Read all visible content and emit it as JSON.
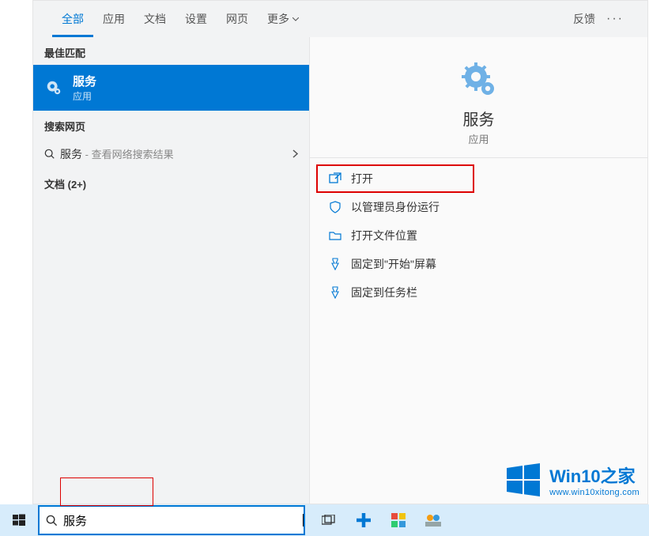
{
  "tabs": {
    "all": "全部",
    "apps": "应用",
    "docs": "文档",
    "settings": "设置",
    "web": "网页",
    "more": "更多",
    "feedback": "反馈",
    "ellipsis": "···"
  },
  "left": {
    "best_label": "最佳匹配",
    "best_title": "服务",
    "best_sub": "应用",
    "web_label": "搜索网页",
    "web_term": "服务",
    "web_dash": " - ",
    "web_sub": "查看网络搜索结果",
    "docs_label": "文档 (2+)"
  },
  "detail": {
    "title": "服务",
    "sub": "应用",
    "actions": {
      "open": "打开",
      "run_admin": "以管理员身份运行",
      "open_location": "打开文件位置",
      "pin_start": "固定到\"开始\"屏幕",
      "pin_taskbar": "固定到任务栏"
    }
  },
  "search": {
    "value": "服务"
  },
  "watermark": {
    "title": "Win10之家",
    "url": "www.win10xitong.com"
  }
}
